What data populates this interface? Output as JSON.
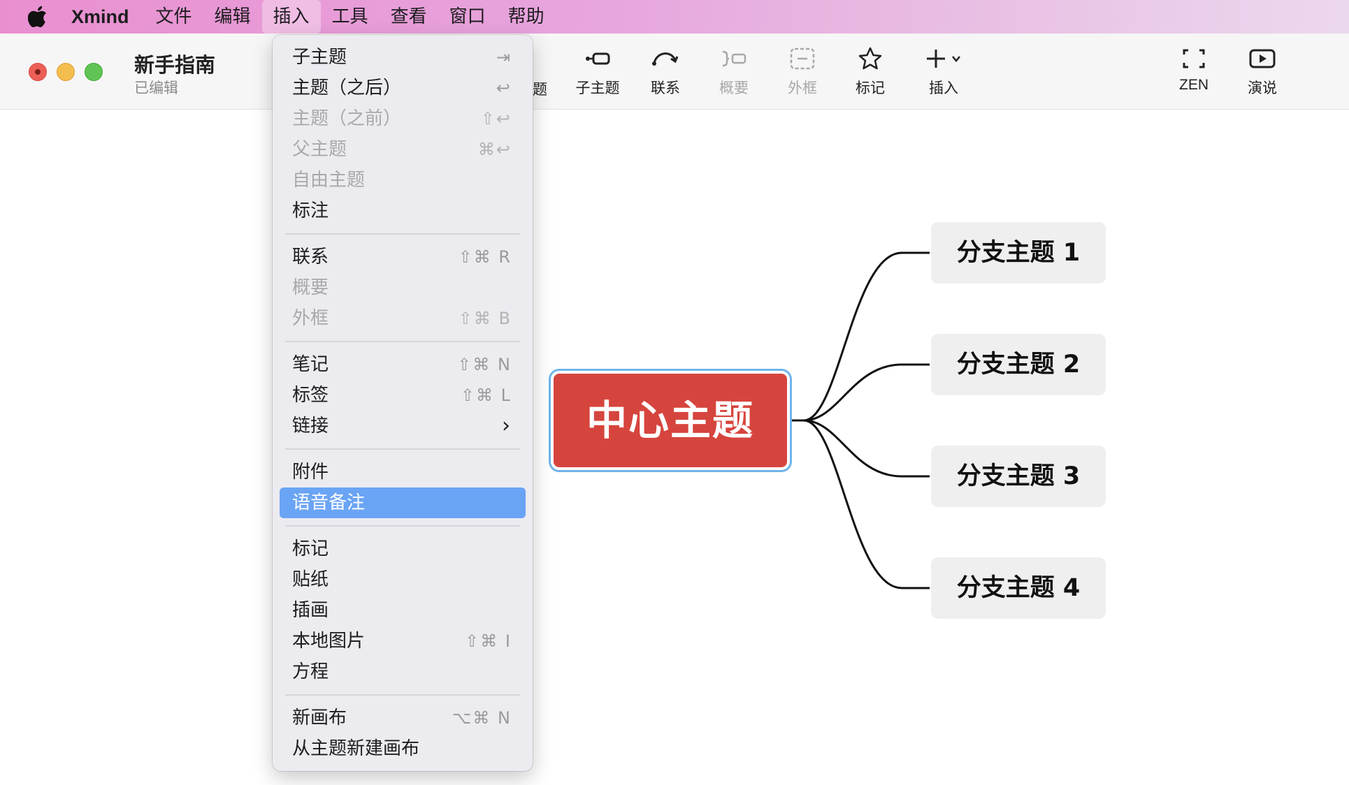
{
  "menubar": {
    "app": "Xmind",
    "items": [
      "文件",
      "编辑",
      "插入",
      "工具",
      "查看",
      "窗口",
      "帮助"
    ]
  },
  "window": {
    "title": "新手指南",
    "subtitle": "已编辑"
  },
  "toolbar": {
    "partial": "题",
    "subtopic": "子主题",
    "relationship": "联系",
    "summary": "概要",
    "boundary": "外框",
    "marker": "标记",
    "insert": "插入",
    "zen": "ZEN",
    "present": "演说"
  },
  "map": {
    "central": "中心主题",
    "branches": [
      "分支主题 1",
      "分支主题 2",
      "分支主题 3",
      "分支主题 4"
    ],
    "colors": {
      "central": "#d6453d",
      "selection": "#6fb4ea",
      "branch_bg": "#efefef"
    }
  },
  "insert_menu": {
    "items": [
      {
        "label": "子主题",
        "shortcut": "⇥",
        "enabled": true
      },
      {
        "label": "主题（之后）",
        "shortcut": "↩",
        "enabled": true
      },
      {
        "label": "主题（之前）",
        "shortcut": "⇧↩",
        "enabled": false
      },
      {
        "label": "父主题",
        "shortcut": "⌘↩",
        "enabled": false
      },
      {
        "label": "自由主题",
        "shortcut": "",
        "enabled": false
      },
      {
        "label": "标注",
        "shortcut": "",
        "enabled": true
      },
      {
        "label": "联系",
        "shortcut": "⇧⌘ R",
        "enabled": true
      },
      {
        "label": "概要",
        "shortcut": "",
        "enabled": false
      },
      {
        "label": "外框",
        "shortcut": "⇧⌘ B",
        "enabled": false
      },
      {
        "label": "笔记",
        "shortcut": "⇧⌘ N",
        "enabled": true
      },
      {
        "label": "标签",
        "shortcut": "⇧⌘ L",
        "enabled": true
      },
      {
        "label": "链接",
        "shortcut": "›",
        "enabled": true
      },
      {
        "label": "附件",
        "shortcut": "",
        "enabled": true
      },
      {
        "label": "语音备注",
        "shortcut": "",
        "enabled": true,
        "highlighted": true
      },
      {
        "label": "标记",
        "shortcut": "",
        "enabled": true
      },
      {
        "label": "贴纸",
        "shortcut": "",
        "enabled": true
      },
      {
        "label": "插画",
        "shortcut": "",
        "enabled": true
      },
      {
        "label": "本地图片",
        "shortcut": "⇧⌘ I",
        "enabled": true
      },
      {
        "label": "方程",
        "shortcut": "",
        "enabled": true
      },
      {
        "label": "新画布",
        "shortcut": "⌥⌘ N",
        "enabled": true
      },
      {
        "label": "从主题新建画布",
        "shortcut": "",
        "enabled": true
      }
    ]
  }
}
